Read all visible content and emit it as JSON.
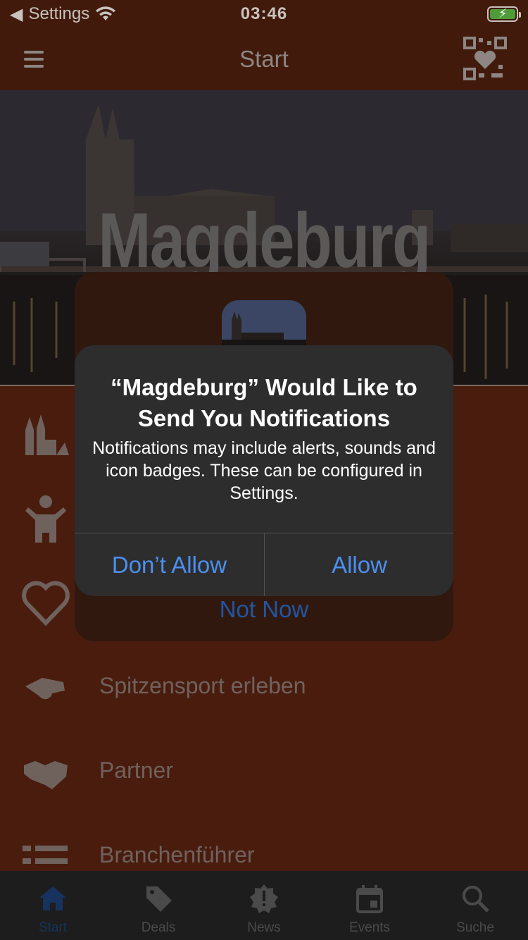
{
  "status_bar": {
    "back_label": "Settings",
    "time": "03:46"
  },
  "nav": {
    "title": "Start"
  },
  "hero": {
    "title": "Magdeburg"
  },
  "menu": {
    "items": [
      {
        "label": "",
        "icon": "cathedral-icon"
      },
      {
        "label": "",
        "icon": "person-icon"
      },
      {
        "label": "",
        "icon": "heart-icon"
      },
      {
        "label": "Spitzensport erleben",
        "icon": "whistle-icon"
      },
      {
        "label": "Partner",
        "icon": "handshake-icon"
      },
      {
        "label": "Branchenführer",
        "icon": "list-icon"
      }
    ]
  },
  "tab_bar": {
    "tabs": [
      {
        "label": "Start",
        "icon": "home-icon",
        "active": true
      },
      {
        "label": "Deals",
        "icon": "tag-icon",
        "active": false
      },
      {
        "label": "News",
        "icon": "alert-badge-icon",
        "active": false
      },
      {
        "label": "Events",
        "icon": "calendar-icon",
        "active": false
      },
      {
        "label": "Suche",
        "icon": "search-icon",
        "active": false
      }
    ]
  },
  "rating_sheet": {
    "not_now_label": "Not Now"
  },
  "alert": {
    "title": "“Magdeburg” Would Like to Send You Notifications",
    "message": "Notifications may include alerts, sounds and icon badges. These can be configured in Settings.",
    "deny_label": "Don’t Allow",
    "allow_label": "Allow"
  },
  "colors": {
    "background": "#491c0e",
    "bar": "#411a0b",
    "alert_bg": "#2d2d2e",
    "button_text": "#4c8fef",
    "active_tab": "#17335d"
  }
}
